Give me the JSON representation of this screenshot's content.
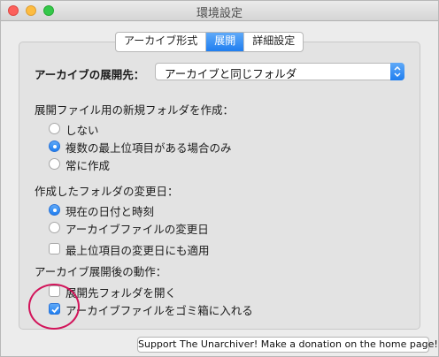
{
  "window": {
    "title": "環境設定"
  },
  "tabs": [
    {
      "label": "アーカイブ形式",
      "active": false
    },
    {
      "label": "展開",
      "active": true
    },
    {
      "label": "詳細設定",
      "active": false
    }
  ],
  "extract_to": {
    "label": "アーカイブの展開先：",
    "value": "アーカイブと同じフォルダ"
  },
  "new_folder": {
    "heading": "展開ファイル用の新規フォルダを作成：",
    "options": [
      {
        "label": "しない",
        "selected": false
      },
      {
        "label": "複数の最上位項目がある場合のみ",
        "selected": true
      },
      {
        "label": "常に作成",
        "selected": false
      }
    ]
  },
  "modification_date": {
    "heading": "作成したフォルダの変更日：",
    "options": [
      {
        "label": "現在の日付と時刻",
        "selected": true
      },
      {
        "label": "アーカイブファイルの変更日",
        "selected": false
      }
    ],
    "checkbox": {
      "label": "最上位項目の変更日にも適用",
      "checked": false
    }
  },
  "after_extract": {
    "heading": "アーカイブ展開後の動作：",
    "options": [
      {
        "label": "展開先フォルダを開く",
        "checked": false
      },
      {
        "label": "アーカイブファイルをゴミ箱に入れる",
        "checked": true
      }
    ]
  },
  "donate_button": "Support The Unarchiver! Make a donation on the home page!",
  "colors": {
    "accent": "#1f7ef0",
    "annotation": "#d2145a"
  }
}
